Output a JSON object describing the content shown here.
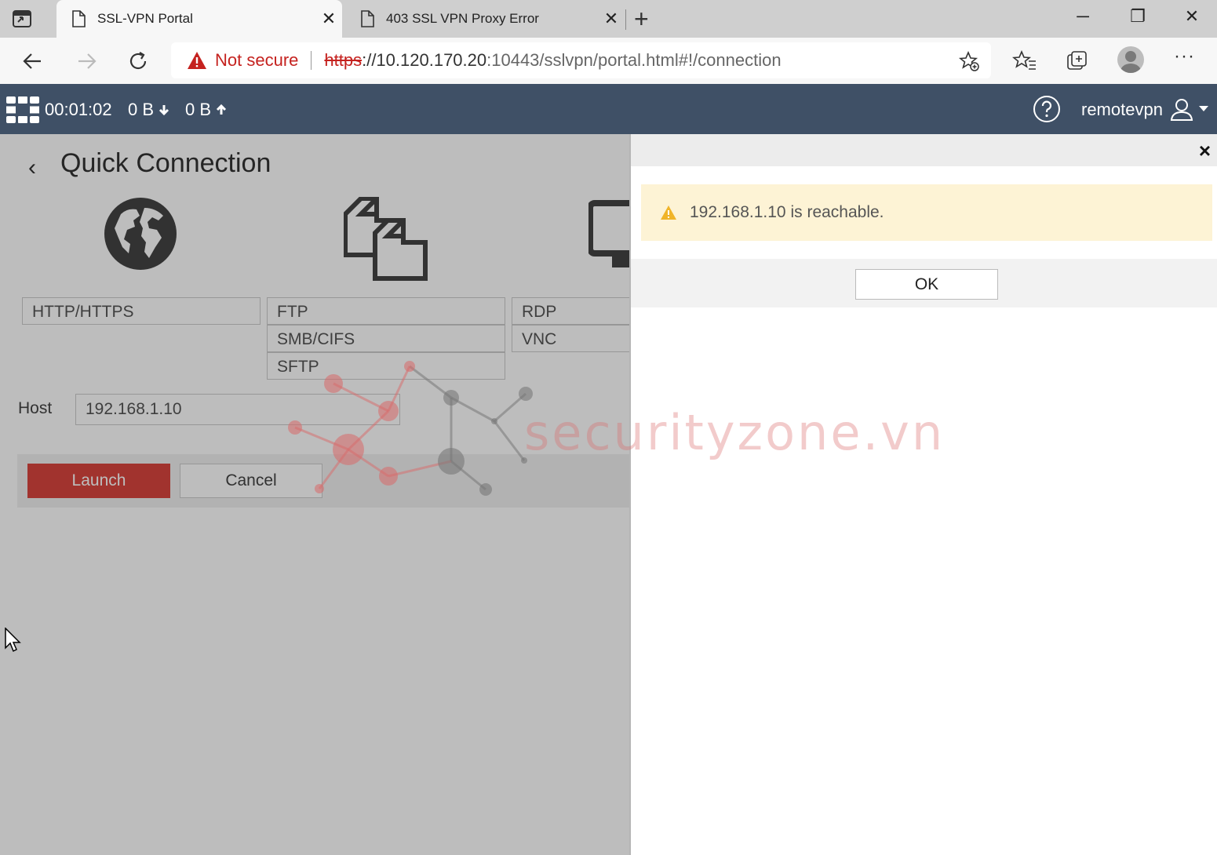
{
  "browser": {
    "tabs": [
      {
        "title": "SSL-VPN Portal",
        "active": true
      },
      {
        "title": "403 SSL VPN Proxy Error",
        "active": false
      }
    ],
    "new_tab": "+",
    "window_controls": {
      "minimize": "─",
      "restore": "❐",
      "close": "✕"
    },
    "address": {
      "security_label": "Not secure",
      "scheme": "https",
      "host": "://10.120.170.20",
      "path": ":10443/sslvpn/portal.html#!/connection"
    },
    "more_menu": "···"
  },
  "portal_header": {
    "session_time": "00:01:02",
    "bytes_down": "0 B",
    "bytes_up": "0 B",
    "username": "remotevpn"
  },
  "quick_connection": {
    "title": "Quick Connection",
    "services": [
      [
        "HTTP/HTTPS"
      ],
      [
        "FTP",
        "SMB/CIFS",
        "SFTP"
      ],
      [
        "RDP",
        "VNC"
      ]
    ],
    "host_label": "Host",
    "host_value": "192.168.1.10",
    "launch_label": "Launch",
    "cancel_label": "Cancel"
  },
  "dialog": {
    "message": "192.168.1.10 is reachable.",
    "ok_label": "OK",
    "close": "×"
  },
  "watermark": "securityzone.vn",
  "colors": {
    "header_bg": "#3f5066",
    "launch": "#d9463f",
    "alert_bg": "#fdf3d5",
    "alert_icon": "#f0b429",
    "not_secure": "#c5221f"
  }
}
